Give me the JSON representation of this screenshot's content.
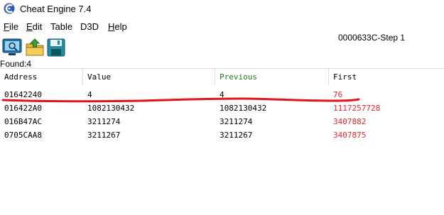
{
  "window": {
    "title": "Cheat Engine 7.4"
  },
  "menu": [
    {
      "label": "File",
      "underline": "F",
      "rest": "ile"
    },
    {
      "label": "Edit",
      "underline": "E",
      "rest": "dit"
    },
    {
      "label": "Table",
      "underline": "",
      "rest": "Table"
    },
    {
      "label": "D3D",
      "underline": "",
      "rest": "D3D"
    },
    {
      "label": "Help",
      "underline": "H",
      "rest": "elp"
    }
  ],
  "toolbar": {
    "process": "0000633C-Step 1",
    "progress_fraction": 0
  },
  "results": {
    "found_label": "Found:4",
    "columns": [
      {
        "label": "Address",
        "color": "#000000"
      },
      {
        "label": "Value",
        "color": "#000000"
      },
      {
        "label": "Previous",
        "color": "#1e7b1e"
      },
      {
        "label": "First",
        "color": "#000000"
      }
    ],
    "rows": [
      {
        "address": "01642240",
        "value": "4",
        "previous": "4",
        "first": "76"
      },
      {
        "address": "016422A0",
        "value": "1082130432",
        "previous": "1082130432",
        "first": "1117257728"
      },
      {
        "address": "016B47AC",
        "value": "3211274",
        "previous": "3211274",
        "first": "3407882"
      },
      {
        "address": "0705CAA8",
        "value": "3211267",
        "previous": "3211267",
        "first": "3407875"
      }
    ]
  },
  "colors": {
    "first_value": "#e8252b",
    "annotation": "#e0141a"
  }
}
